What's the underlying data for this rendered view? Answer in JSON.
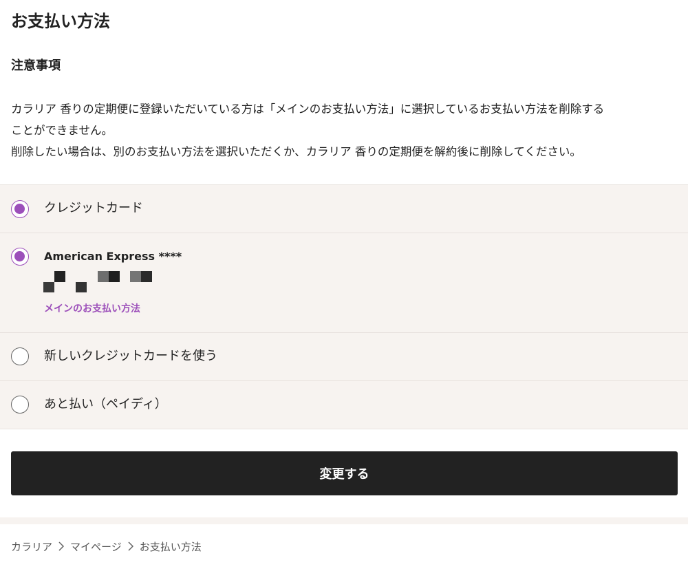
{
  "page": {
    "title": "お支払い方法"
  },
  "notes": {
    "heading": "注意事項",
    "line1": "カラリア 香りの定期便に登録いただいている方は「メインのお支払い方法」に選択しているお支払い方法を削除する",
    "line2": "ことができません。",
    "line3": "削除したい場合は、別のお支払い方法を選択いただくか、カラリア 香りの定期便を解約後に削除してください。"
  },
  "payment_methods": {
    "credit_card": {
      "label": "クレジットカード",
      "selected": true
    },
    "saved_card": {
      "brand_label": "American Express ****",
      "main_badge": "メインのお支払い方法",
      "selected": true
    },
    "new_card": {
      "label": "新しいクレジットカードを使う",
      "selected": false
    },
    "paidy": {
      "label": "あと払い（ペイディ）",
      "selected": false
    }
  },
  "actions": {
    "submit_label": "変更する"
  },
  "breadcrumb": {
    "items": [
      "カラリア",
      "マイページ",
      "お支払い方法"
    ],
    "separator_icon": "chevron-right-icon"
  },
  "colors": {
    "accent": "#9c4fba",
    "panel_background": "#f7f3f0",
    "button_background": "#222222"
  }
}
